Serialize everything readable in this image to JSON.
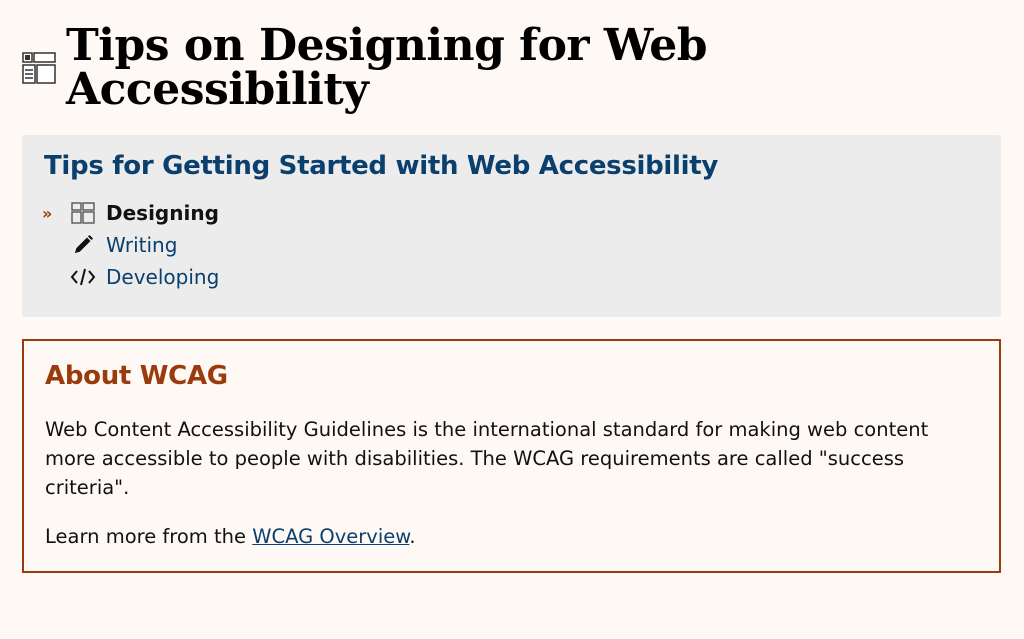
{
  "header": {
    "icon": "layout-icon",
    "title": "Tips on Designing for Web Accessibility"
  },
  "nav": {
    "heading": "Tips for Getting Started with Web Accessibility",
    "current_marker": "»",
    "items": [
      {
        "label": "Designing",
        "icon": "layout-icon",
        "current": true
      },
      {
        "label": "Writing",
        "icon": "pencil-icon",
        "current": false
      },
      {
        "label": "Developing",
        "icon": "code-icon",
        "current": false
      }
    ]
  },
  "about": {
    "heading": "About WCAG",
    "description": "Web Content Accessibility Guidelines is the international standard for making web content more accessible to people with disabilities. The WCAG requirements are called \"success criteria\".",
    "learn_prefix": "Learn more from the ",
    "link_label": "WCAG Overview",
    "learn_suffix": "."
  },
  "colors": {
    "background": "#fff9f5",
    "nav_background": "#ececec",
    "link": "#0b3f6e",
    "accent": "#9a3b0d"
  }
}
